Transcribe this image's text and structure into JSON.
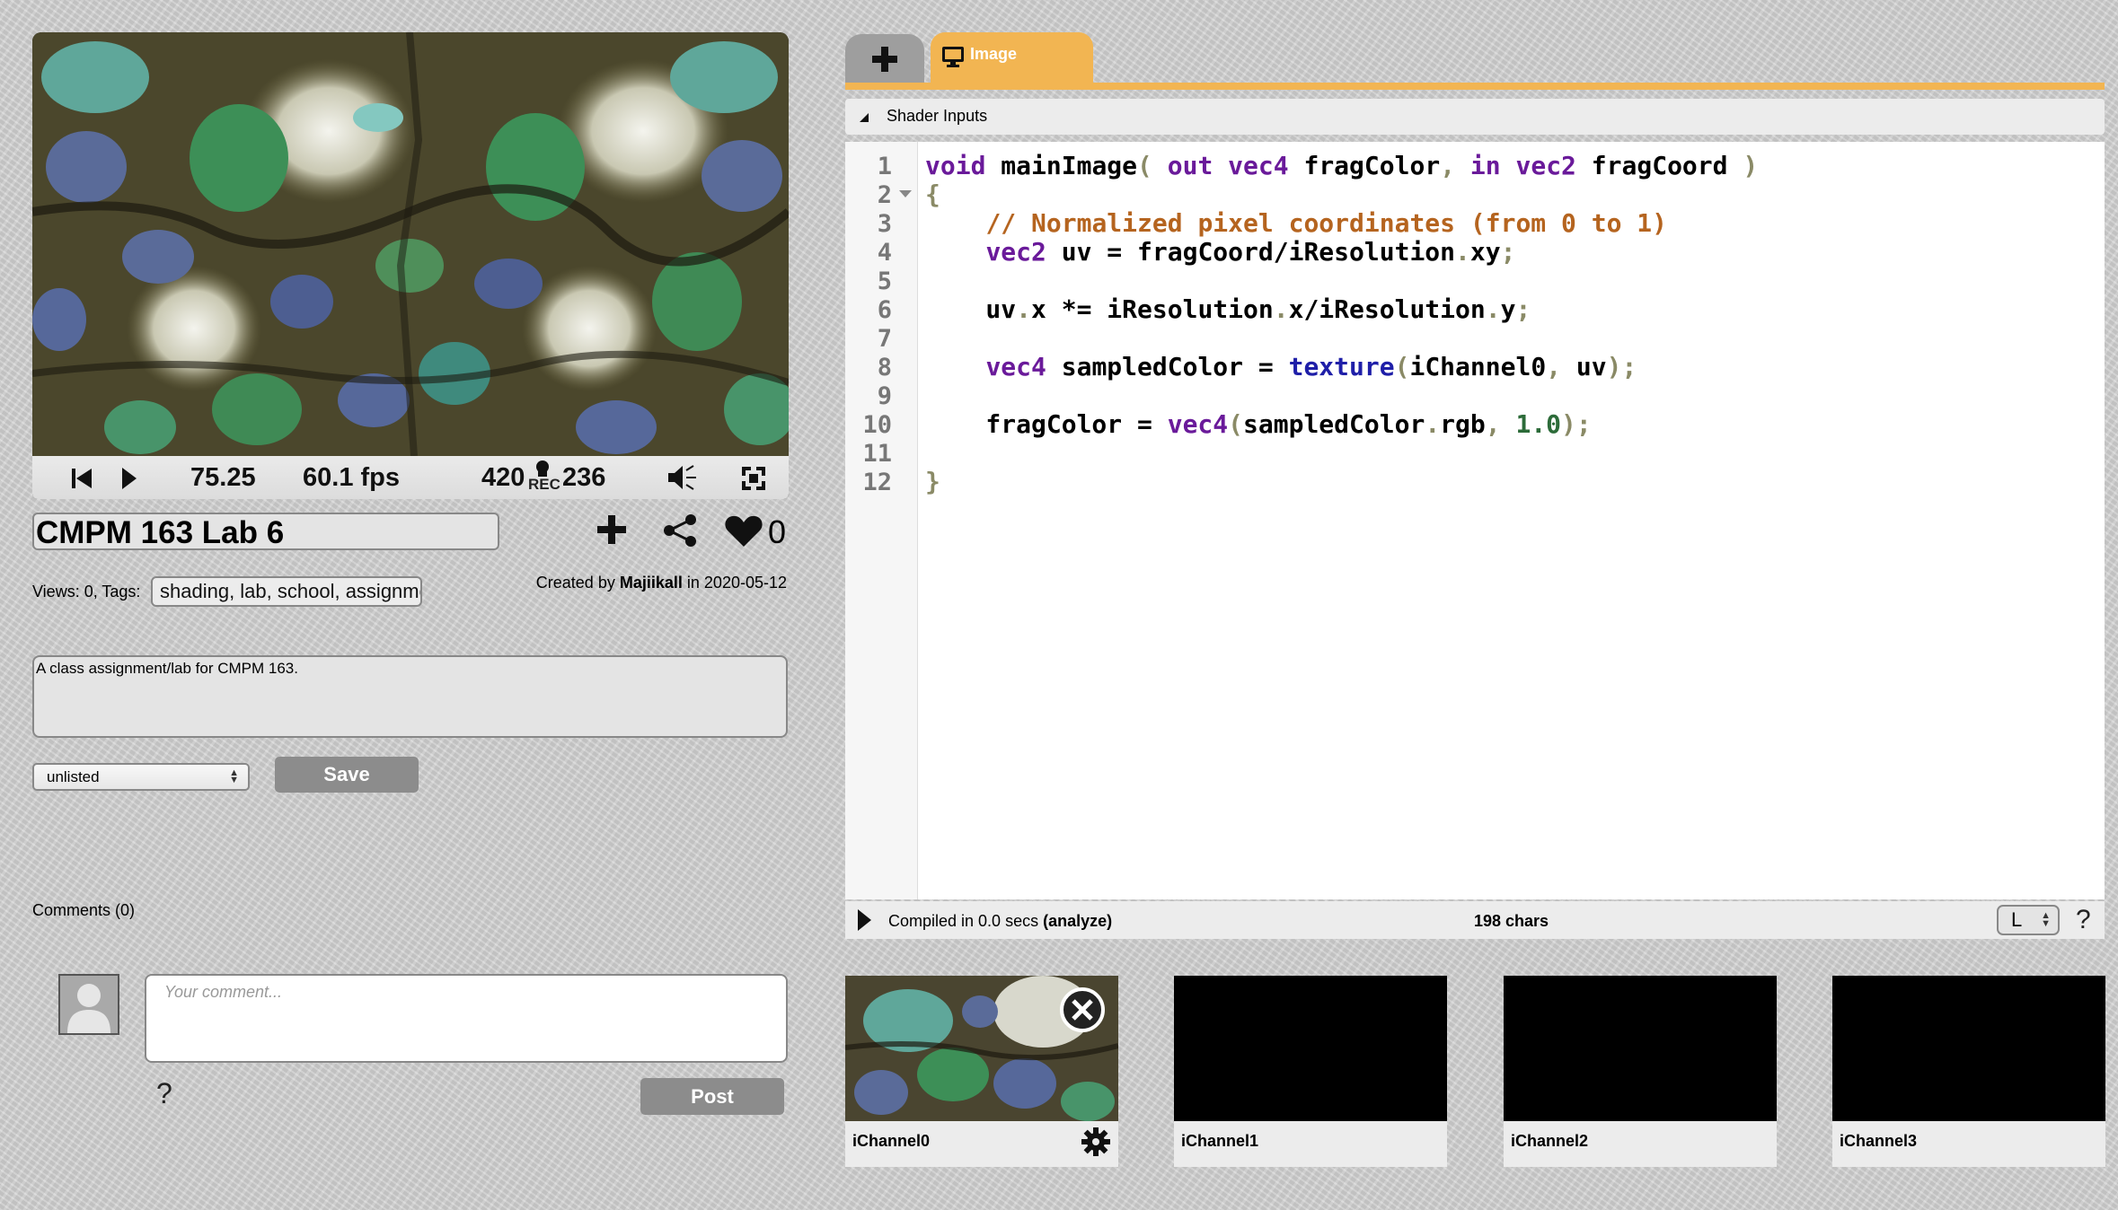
{
  "player": {
    "time": "75.25",
    "fps": "60.1 fps",
    "resolution_w": "420",
    "resolution_h": "236",
    "rec_label": "REC"
  },
  "shader": {
    "title": "CMPM  163 Lab 6",
    "likes": "0",
    "views_tags_label": "Views: 0, Tags:",
    "tags": "shading, lab, school, assignment",
    "created_by_prefix": "Created by",
    "author": "Majiikall",
    "created_in": "in 2020-05-12",
    "description": "A class assignment/lab for CMPM 163.",
    "visibility": "unlisted",
    "save_label": "Save"
  },
  "comments": {
    "label": "Comments (0)",
    "placeholder": "Your comment...",
    "help": "?",
    "post_label": "Post"
  },
  "editor": {
    "tab_add_label": "+",
    "tab_image_label": "Image",
    "shader_inputs_label": "Shader Inputs",
    "line_numbers": [
      "1",
      "2",
      "3",
      "4",
      "5",
      "6",
      "7",
      "8",
      "9",
      "10",
      "11",
      "12"
    ],
    "compiled_text": "Compiled in 0.0 secs",
    "analyze_label": "(analyze)",
    "chars": "198 chars",
    "font_size": "L",
    "help": "?"
  },
  "channels": [
    {
      "label": "iChannel0"
    },
    {
      "label": "iChannel1"
    },
    {
      "label": "iChannel2"
    },
    {
      "label": "iChannel3"
    }
  ],
  "colors": {
    "accent": "#f2b552",
    "keyword": "#6a1a9a",
    "comment": "#b5641f",
    "builtin": "#1f1fa8",
    "number": "#2c6b39"
  }
}
